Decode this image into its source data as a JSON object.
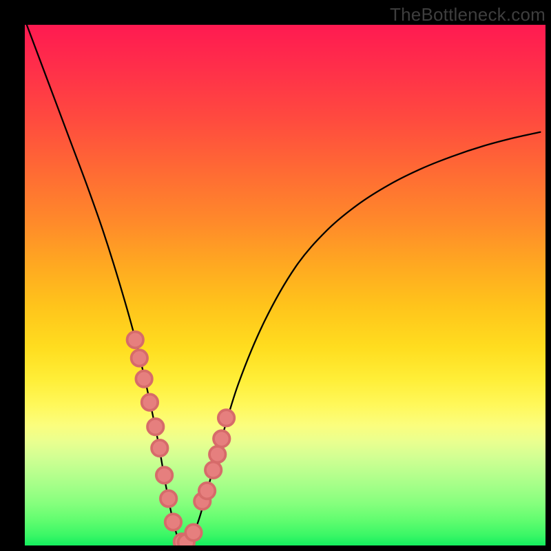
{
  "watermark": "TheBottleneck.com",
  "chart_data": {
    "type": "line",
    "title": "",
    "xlabel": "",
    "ylabel": "",
    "xlim": [
      0,
      100
    ],
    "ylim": [
      0,
      100
    ],
    "grid": false,
    "series": [
      {
        "name": "bottleneck-curve",
        "x": [
          0,
          3,
          6,
          9,
          12,
          15,
          18,
          21,
          23.5,
          25.5,
          27,
          28.3,
          29.5,
          30.7,
          32,
          33.5,
          35.3,
          37.5,
          41,
          46,
          52,
          58,
          64,
          70,
          76,
          82,
          88,
          94,
          99
        ],
        "y": [
          101,
          93,
          85,
          77,
          69,
          60.5,
          51,
          40.5,
          30,
          20.5,
          12,
          5.5,
          1.2,
          0.4,
          1.4,
          5.2,
          11.5,
          19.5,
          31,
          43,
          53.5,
          60.5,
          65.5,
          69.3,
          72.3,
          74.7,
          76.7,
          78.3,
          79.4
        ]
      }
    ],
    "markers": {
      "name": "highlighted-points",
      "x": [
        21.2,
        22.0,
        22.9,
        24.0,
        25.1,
        25.9,
        26.8,
        27.6,
        28.5,
        30.2,
        31.0,
        32.4,
        34.1,
        35.0,
        36.2,
        37.0,
        37.8,
        38.7
      ],
      "y": [
        39.5,
        36.0,
        32.0,
        27.5,
        22.8,
        18.7,
        13.5,
        9.0,
        4.5,
        0.7,
        0.6,
        2.5,
        8.5,
        10.5,
        14.5,
        17.5,
        20.5,
        24.5
      ]
    },
    "gradient_stops": [
      {
        "pos": 0.0,
        "color": "#ff1a51"
      },
      {
        "pos": 0.5,
        "color": "#ffc41b"
      },
      {
        "pos": 0.75,
        "color": "#fbfe7e"
      },
      {
        "pos": 1.0,
        "color": "#14ef5e"
      }
    ]
  }
}
